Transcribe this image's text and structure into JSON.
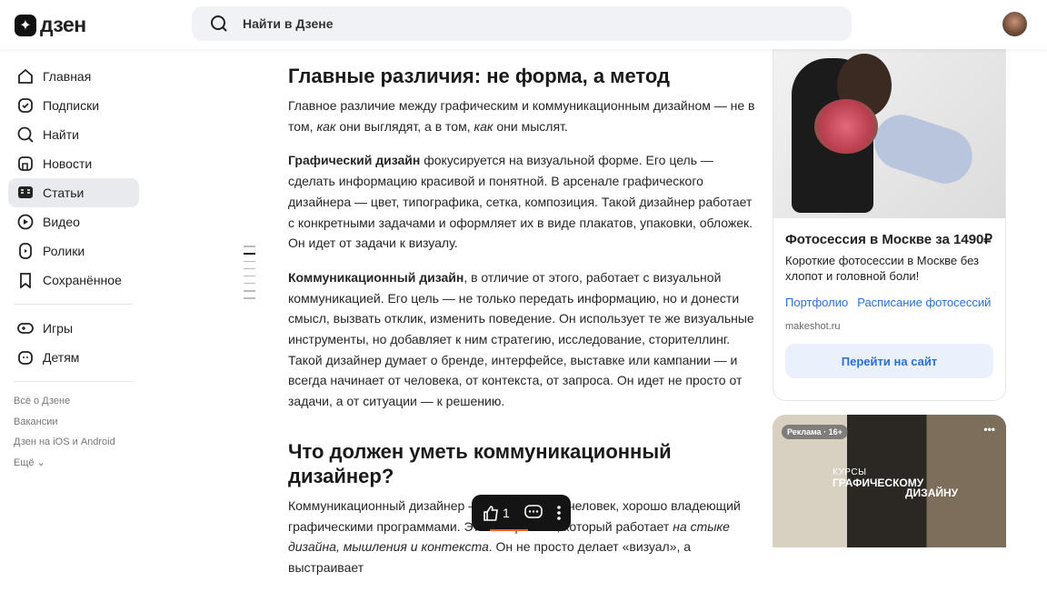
{
  "header": {
    "logo": "дзен",
    "search_placeholder": "Найти в Дзене"
  },
  "sidebar": {
    "items": [
      {
        "label": "Главная",
        "icon": "home-icon"
      },
      {
        "label": "Подписки",
        "icon": "subscriptions-icon"
      },
      {
        "label": "Найти",
        "icon": "search-icon"
      },
      {
        "label": "Новости",
        "icon": "news-icon"
      },
      {
        "label": "Статьи",
        "icon": "articles-icon",
        "active": true
      },
      {
        "label": "Видео",
        "icon": "video-icon"
      },
      {
        "label": "Ролики",
        "icon": "shorts-icon"
      },
      {
        "label": "Сохранённое",
        "icon": "bookmark-icon"
      }
    ],
    "extra": [
      {
        "label": "Игры",
        "icon": "games-icon"
      },
      {
        "label": "Детям",
        "icon": "kids-icon"
      }
    ],
    "footer": [
      "Всё о Дзене",
      "Вакансии",
      "Дзен на iOS и Android",
      "Ещё"
    ]
  },
  "article": {
    "h1": "Главные различия: не форма, а метод",
    "p1": {
      "a": "Главное различие между графическим и коммуникационным дизайном — не в том, ",
      "b": "как",
      "c": " они выглядят, а в том, ",
      "d": "как",
      "e": " они мыслят."
    },
    "p2": {
      "bold": "Графический дизайн",
      "rest": " фокусируется на визуальной форме. Его цель — сделать информацию красивой и понятной. В арсенале графического дизайнера — цвет, типографика, сетка, композиция. Такой дизайнер работает с конкретными задачами и оформляет их в виде плакатов, упаковки, обложек. Он идет от задачи к визуалу."
    },
    "p3": {
      "bold": "Коммуникационный дизайн",
      "rest": ", в отличие от этого, работает с визуальной коммуникацией. Его цель — не только передать информацию, но и донести смысл, вызвать отклик, изменить поведение. Он использует те же визуальные инструменты, но добавляет к ним стратегию, исследование, сторителлинг. Такой дизайнер думает о бренде, интерфейсе, выставке или кампании — и всегда начинает от человека, от контекста, от запроса. Он идет не просто от задачи, а от ситуации — к решению."
    },
    "h2": "Что должен уметь коммуникационный дизайнер?",
    "p4": {
      "a": "Коммуникационный дизайнер — это не просто человек, хорошо владеющий графическими программами. Это специалист, который работает ",
      "i": "на стыке дизайна, мышления и контекста",
      "b": ". Он не просто делает «визуал», а выстраивает"
    }
  },
  "actions": {
    "likes": "1"
  },
  "ads": [
    {
      "title": "Фотосессия в Москве за 1490₽",
      "desc": "Короткие фотосессии в Москве без хлопот и головной боли!",
      "links": [
        "Портфолио",
        "Расписание фотосессий"
      ],
      "domain": "makeshot.ru",
      "button": "Перейти на сайт"
    },
    {
      "label": "Реклама · 16+",
      "line1": "КУРСЫ",
      "line2": "ГРАФИЧЕСКОМУ",
      "line3": "ДИЗАЙНУ"
    }
  ],
  "colors": {
    "accent": "#2b6fd6",
    "active_bg": "#e9eaee",
    "progress": "#ff5a1f"
  }
}
